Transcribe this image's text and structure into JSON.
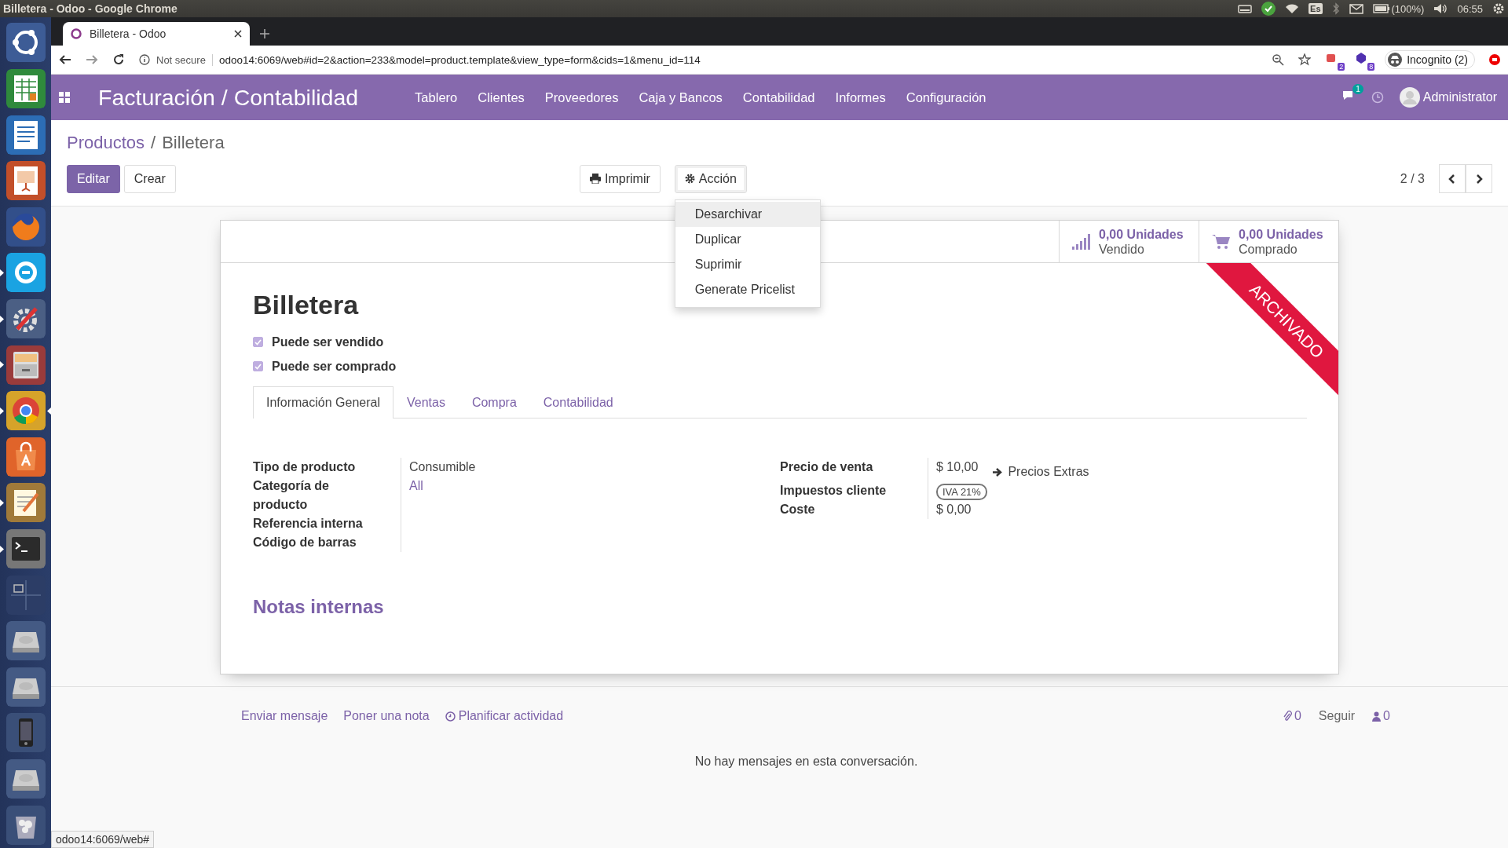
{
  "top_bar": {
    "title": "Billetera - Odoo - Google Chrome",
    "keyboard_layout": "Es",
    "battery": "(100%)",
    "clock": "06:55"
  },
  "dock": [
    {
      "kind": "launcher",
      "running": false,
      "focused": false
    },
    {
      "kind": "spreadsheet",
      "running": false,
      "focused": false
    },
    {
      "kind": "writer",
      "running": false,
      "focused": false
    },
    {
      "kind": "presentation",
      "running": false,
      "focused": false
    },
    {
      "kind": "firefox",
      "running": false,
      "focused": false
    },
    {
      "kind": "skype",
      "running": true,
      "focused": false
    },
    {
      "kind": "settings",
      "running": true,
      "focused": false
    },
    {
      "kind": "files",
      "running": true,
      "focused": false
    },
    {
      "kind": "chrome",
      "running": true,
      "focused": true
    },
    {
      "kind": "software",
      "running": false,
      "focused": false
    },
    {
      "kind": "editor",
      "running": true,
      "focused": false
    },
    {
      "kind": "terminal",
      "running": true,
      "focused": false
    },
    {
      "kind": "workspaces",
      "running": false,
      "focused": false
    },
    {
      "kind": "drive",
      "running": false,
      "focused": false
    },
    {
      "kind": "drive",
      "running": false,
      "focused": false
    },
    {
      "kind": "phone",
      "running": false,
      "focused": false
    },
    {
      "kind": "drive",
      "running": false,
      "focused": false
    },
    {
      "kind": "trash",
      "running": false,
      "focused": false
    }
  ],
  "browser": {
    "tabs": [
      {
        "title": "Billetera - Odoo",
        "selected": true
      }
    ],
    "security": "Not secure",
    "url": "odoo14:6069/web#id=2&action=233&model=product.template&view_type=form&cids=1&menu_id=114",
    "extension_badges": [
      "2",
      "8"
    ],
    "profile": "Incognito (2)",
    "status_bubble": "odoo14:6069/web#"
  },
  "navbar": {
    "app_title": "Facturación / Contabilidad",
    "menu": [
      "Tablero",
      "Clientes",
      "Proveedores",
      "Caja y Bancos",
      "Contabilidad",
      "Informes",
      "Configuración"
    ],
    "messages_badge": "1",
    "user": "Administrator"
  },
  "breadcrumb_separator": "/",
  "breadcrumb": [
    {
      "label": "Productos",
      "kind": "link"
    },
    {
      "label": "Billetera",
      "kind": "current"
    }
  ],
  "buttons": [
    {
      "label": "Editar",
      "kind": "primary"
    },
    {
      "label": "Crear",
      "kind": "secondary"
    }
  ],
  "actions": [
    {
      "label": "Imprimir",
      "kind": "print",
      "open": false
    },
    {
      "label": "Acción",
      "kind": "gear",
      "open": true
    }
  ],
  "action_menu": [
    {
      "label": "Desarchivar",
      "selected": true
    },
    {
      "label": "Duplicar",
      "selected": false
    },
    {
      "label": "Suprimir",
      "selected": false
    },
    {
      "label": "Generate Pricelist",
      "selected": false
    }
  ],
  "pager": "2 / 3",
  "stat_buttons": [
    {
      "value": "0,00 Unidades",
      "label": "Vendido",
      "kind": "chart"
    },
    {
      "value": "0,00 Unidades",
      "label": "Comprado",
      "kind": "cart"
    }
  ],
  "ribbon": "ARCHIVADO",
  "product": {
    "name": "Billetera",
    "options": [
      {
        "label": "Puede ser vendido",
        "checked": true
      },
      {
        "label": "Puede ser comprado",
        "checked": true
      }
    ]
  },
  "tabs": [
    {
      "label": "Información General",
      "selected": true
    },
    {
      "label": "Ventas",
      "selected": false
    },
    {
      "label": "Compra",
      "selected": false
    },
    {
      "label": "Contabilidad",
      "selected": false
    }
  ],
  "fields_left": [
    {
      "label": "Tipo de producto",
      "value": "Consumible",
      "kind": "text"
    },
    {
      "label": "Categoría de producto",
      "value": "All",
      "kind": "link"
    },
    {
      "label": "Referencia interna",
      "kind": "empty"
    },
    {
      "label": "Código de barras",
      "kind": "empty"
    }
  ],
  "fields_right": [
    {
      "label": "Precio de venta",
      "value": "$ 10,00",
      "extra": "Precios Extras",
      "kind": "price"
    },
    {
      "label": "Impuestos cliente",
      "value": "IVA 21%",
      "kind": "tag"
    },
    {
      "label": "Coste",
      "value": "$ 0,00",
      "kind": "text"
    }
  ],
  "notes_title": "Notas internas",
  "chatter": {
    "links": [
      {
        "label": "Enviar mensaje",
        "kind": "plain"
      },
      {
        "label": "Poner una nota",
        "kind": "plain"
      },
      {
        "label": "Planificar actividad",
        "kind": "clock"
      }
    ],
    "attachments": "0",
    "follow": "Seguir",
    "followers": "0",
    "empty_message": "No hay mensajes en esta conversación."
  }
}
